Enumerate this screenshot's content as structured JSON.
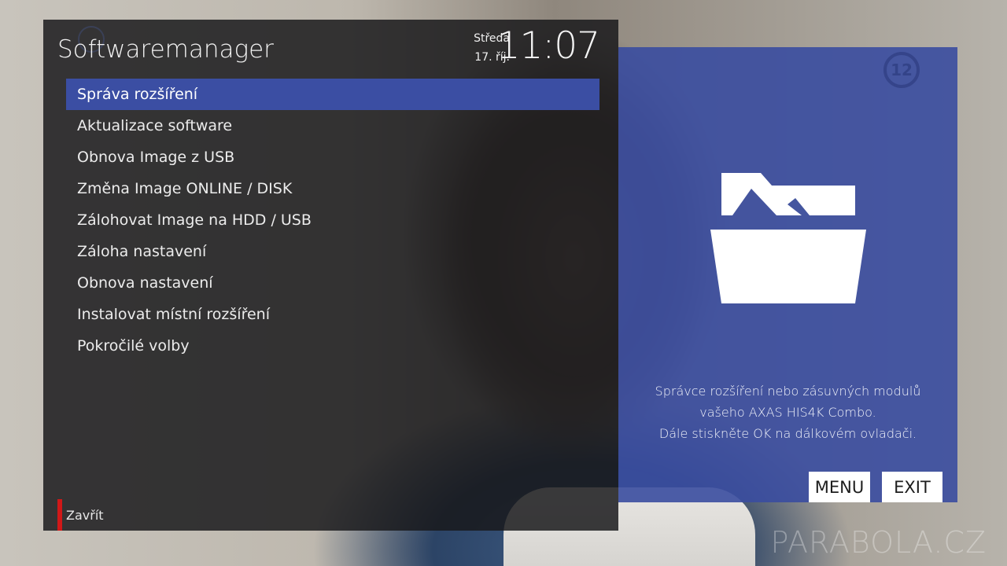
{
  "header": {
    "title": "Softwaremanager",
    "day": "Středa",
    "date": "17. říj.",
    "time": "11:07"
  },
  "menu": {
    "selected_index": 0,
    "items": [
      {
        "label": "Správa rozšíření"
      },
      {
        "label": "Aktualizace software"
      },
      {
        "label": "Obnova Image z USB"
      },
      {
        "label": "Změna Image ONLINE / DISK"
      },
      {
        "label": "Zálohovat Image na HDD / USB"
      },
      {
        "label": "Záloha nastavení"
      },
      {
        "label": "Obnova nastavení"
      },
      {
        "label": "Instalovat místní rozšíření"
      },
      {
        "label": "Pokročilé volby"
      }
    ]
  },
  "footer": {
    "close_label": "Zavřít",
    "close_color": "#d01818"
  },
  "info": {
    "icon": "open-folder-icon",
    "channel_logo": "12",
    "lines": [
      "Správce rozšíření nebo zásuvných modulů",
      "vašeho AXAS HIS4K Combo.",
      "Dále stiskněte OK na dálkovém ovladači."
    ],
    "menu_button": "MENU",
    "exit_button": "EXIT"
  },
  "watermark": "PARABOLA.CZ",
  "colors": {
    "accent": "#3b4ea3",
    "info_panel": "#3a4ca0",
    "red_key": "#d01818"
  }
}
